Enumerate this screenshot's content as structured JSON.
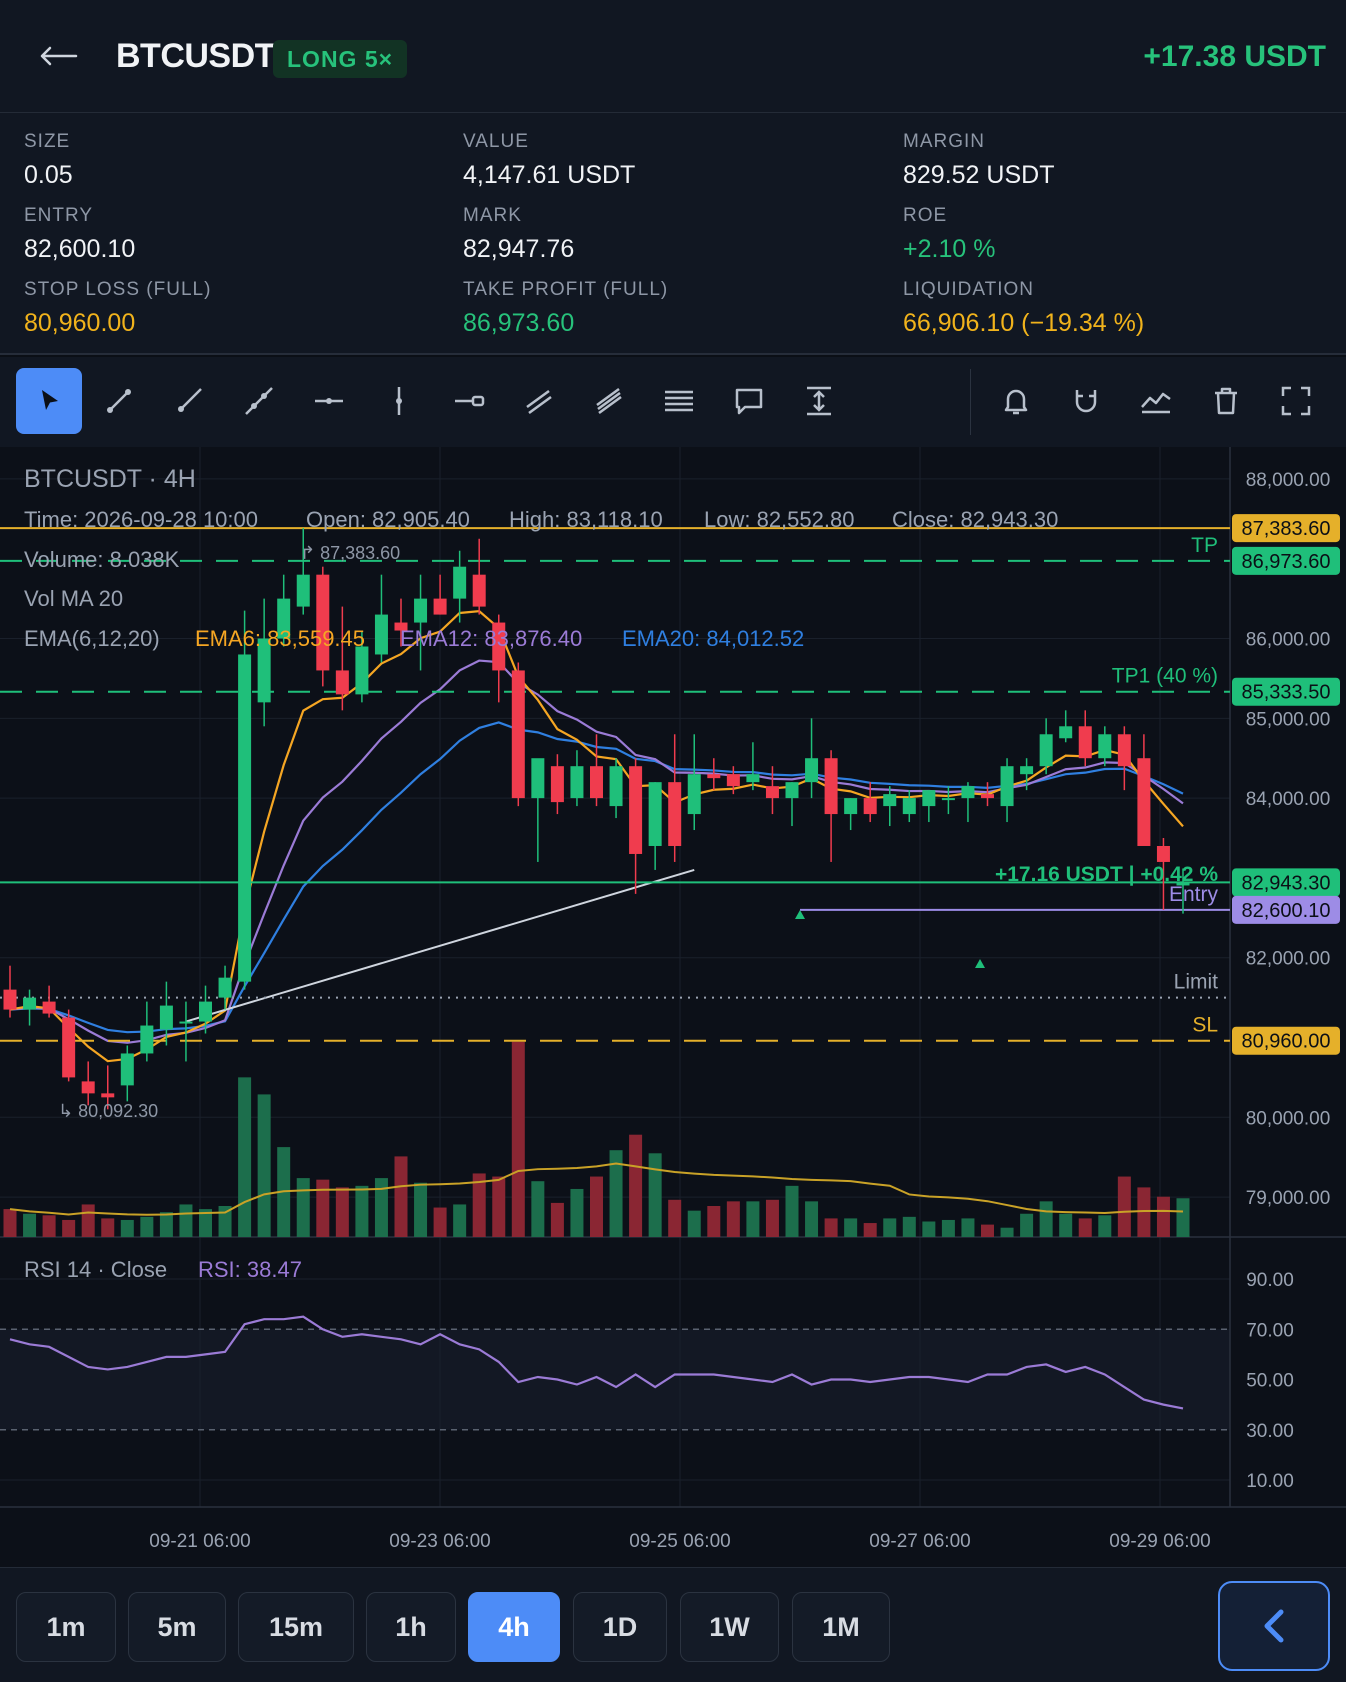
{
  "header": {
    "symbol": "BTCUSDT",
    "position_badge": "LONG 5×",
    "unrealized_pnl": "+17.38 USDT"
  },
  "stats": [
    {
      "label": "SIZE",
      "value": "0.05",
      "tone": "normal"
    },
    {
      "label": "VALUE",
      "value": "4,147.61 USDT",
      "tone": "normal"
    },
    {
      "label": "MARGIN",
      "value": "829.52 USDT",
      "tone": "normal"
    },
    {
      "label": "ENTRY",
      "value": "82,600.10",
      "tone": "normal"
    },
    {
      "label": "MARK",
      "value": "82,947.76",
      "tone": "normal"
    },
    {
      "label": "ROE",
      "value": "+2.10 %",
      "tone": "green"
    },
    {
      "label": "STOP LOSS (FULL)",
      "value": "80,960.00",
      "tone": "amber"
    },
    {
      "label": "TAKE PROFIT (FULL)",
      "value": "86,973.60",
      "tone": "green"
    },
    {
      "label": "LIQUIDATION",
      "value": "66,906.10 (−19.34 %)",
      "tone": "amber"
    }
  ],
  "toolbar": {
    "tools": [
      "cursor-icon",
      "trend-line-icon",
      "ray-icon",
      "extended-line-icon",
      "horizontal-line-icon",
      "vertical-line-icon",
      "horizontal-ray-icon",
      "parallel-channel-icon",
      "regression-channel-icon",
      "fib-levels-icon",
      "callout-icon",
      "price-range-icon"
    ],
    "actions": [
      "alert-bell-icon",
      "magnet-icon",
      "indicators-icon",
      "trash-icon",
      "fullscreen-icon"
    ]
  },
  "chart_data": {
    "type": "candlestick",
    "title": "BTCUSDT · 4H",
    "ohlc_legend": {
      "time": "Time: 2026-09-28 10:00",
      "open": "Open: 82,905.40",
      "high": "High: 83,118.10",
      "low": "Low: 82,552.80",
      "close": "Close: 82,943.30",
      "volume": "Volume: 8.038K",
      "vol_ma": "Vol MA 20"
    },
    "ema_legend": {
      "label": "EMA(6,12,20)",
      "ema6": "EMA6: 83,559.45",
      "ema12": "EMA12: 83,876.40",
      "ema20": "EMA20: 84,012.52"
    },
    "price_axis_ticks": [
      "88,000.00",
      "86,000.00",
      "85,000.00",
      "84,000.00",
      "82,000.00",
      "80,000.00",
      "79,000.00"
    ],
    "time_axis_ticks": [
      "09-21 06:00",
      "09-23 06:00",
      "09-25 06:00",
      "09-27 06:00",
      "09-29 06:00"
    ],
    "markers": {
      "swing_high": "87,383.60",
      "swing_low": "80,092.30"
    },
    "price_levels": [
      {
        "label": "",
        "price": 87383.6,
        "tag": "87,383.60",
        "color": "#e5b02a",
        "style": "solid"
      },
      {
        "label": "TP",
        "price": 86973.6,
        "tag": "86,973.60",
        "color": "#1fbf7a",
        "style": "dashed"
      },
      {
        "label": "TP1 (40 %)",
        "price": 85333.5,
        "tag": "85,333.50",
        "color": "#1fbf7a",
        "style": "dashed"
      },
      {
        "label": "",
        "price": 82943.3,
        "tag": "82,943.30",
        "color": "#1fbf7a",
        "style": "solid"
      },
      {
        "label": "Entry",
        "price": 82600.1,
        "tag": "82,600.10",
        "color": "#9d8ce6",
        "style": "solid"
      },
      {
        "label": "Limit",
        "price": 81500,
        "tag": "",
        "color": "#9aa3b2",
        "style": "dotted"
      },
      {
        "label": "SL",
        "price": 80960.0,
        "tag": "80,960.00",
        "color": "#e5b02a",
        "style": "dashed"
      }
    ],
    "position_pnl_label": "+17.16 USDT | +0.42 %",
    "candles": [
      {
        "o": 81600,
        "h": 81900,
        "l": 81250,
        "c": 81350
      },
      {
        "o": 81350,
        "h": 81600,
        "l": 81150,
        "c": 81500
      },
      {
        "o": 81450,
        "h": 81650,
        "l": 81250,
        "c": 81300
      },
      {
        "o": 81250,
        "h": 81350,
        "l": 80450,
        "c": 80500
      },
      {
        "o": 80450,
        "h": 80700,
        "l": 80150,
        "c": 80300
      },
      {
        "o": 80300,
        "h": 80650,
        "l": 80100,
        "c": 80250
      },
      {
        "o": 80400,
        "h": 80900,
        "l": 80200,
        "c": 80800
      },
      {
        "o": 80800,
        "h": 81450,
        "l": 80700,
        "c": 81150
      },
      {
        "o": 81100,
        "h": 81700,
        "l": 80900,
        "c": 81400
      },
      {
        "o": 81200,
        "h": 81450,
        "l": 80700,
        "c": 81200
      },
      {
        "o": 81200,
        "h": 81650,
        "l": 81050,
        "c": 81450
      },
      {
        "o": 81500,
        "h": 81900,
        "l": 81350,
        "c": 81750
      },
      {
        "o": 81700,
        "h": 86350,
        "l": 81600,
        "c": 85800
      },
      {
        "o": 85200,
        "h": 86500,
        "l": 84900,
        "c": 86000
      },
      {
        "o": 86000,
        "h": 86800,
        "l": 85900,
        "c": 86500
      },
      {
        "o": 86400,
        "h": 87383.6,
        "l": 86300,
        "c": 86800
      },
      {
        "o": 86800,
        "h": 86900,
        "l": 85400,
        "c": 85600
      },
      {
        "o": 85600,
        "h": 86400,
        "l": 85100,
        "c": 85300
      },
      {
        "o": 85300,
        "h": 86100,
        "l": 85200,
        "c": 85900
      },
      {
        "o": 85800,
        "h": 86800,
        "l": 85700,
        "c": 86300
      },
      {
        "o": 86200,
        "h": 86500,
        "l": 85900,
        "c": 86100
      },
      {
        "o": 86200,
        "h": 86800,
        "l": 85600,
        "c": 86500
      },
      {
        "o": 86500,
        "h": 86800,
        "l": 86300,
        "c": 86300
      },
      {
        "o": 86500,
        "h": 87100,
        "l": 86200,
        "c": 86900
      },
      {
        "o": 86800,
        "h": 87250,
        "l": 86300,
        "c": 86400
      },
      {
        "o": 86200,
        "h": 86300,
        "l": 85200,
        "c": 85600
      },
      {
        "o": 85600,
        "h": 85700,
        "l": 83900,
        "c": 84000
      },
      {
        "o": 84000,
        "h": 84400,
        "l": 83200,
        "c": 84500
      },
      {
        "o": 84400,
        "h": 84550,
        "l": 83800,
        "c": 83950
      },
      {
        "o": 84000,
        "h": 84600,
        "l": 83900,
        "c": 84400
      },
      {
        "o": 84400,
        "h": 84800,
        "l": 83900,
        "c": 84000
      },
      {
        "o": 83900,
        "h": 84500,
        "l": 83750,
        "c": 84400
      },
      {
        "o": 84400,
        "h": 84500,
        "l": 82800,
        "c": 83300
      },
      {
        "o": 83400,
        "h": 84200,
        "l": 83100,
        "c": 84200
      },
      {
        "o": 84200,
        "h": 84800,
        "l": 83200,
        "c": 83400
      },
      {
        "o": 83800,
        "h": 84800,
        "l": 83600,
        "c": 84300
      },
      {
        "o": 84300,
        "h": 84500,
        "l": 84100,
        "c": 84250
      },
      {
        "o": 84300,
        "h": 84400,
        "l": 84050,
        "c": 84150
      },
      {
        "o": 84200,
        "h": 84700,
        "l": 84100,
        "c": 84300
      },
      {
        "o": 84150,
        "h": 84400,
        "l": 83800,
        "c": 84000
      },
      {
        "o": 84000,
        "h": 84200,
        "l": 83650,
        "c": 84200
      },
      {
        "o": 84200,
        "h": 85000,
        "l": 84000,
        "c": 84500
      },
      {
        "o": 84500,
        "h": 84600,
        "l": 83200,
        "c": 83800
      },
      {
        "o": 83800,
        "h": 84000,
        "l": 83600,
        "c": 84000
      },
      {
        "o": 84000,
        "h": 84200,
        "l": 83700,
        "c": 83800
      },
      {
        "o": 83900,
        "h": 84150,
        "l": 83650,
        "c": 84050
      },
      {
        "o": 83800,
        "h": 84100,
        "l": 83700,
        "c": 84000
      },
      {
        "o": 83900,
        "h": 84100,
        "l": 83700,
        "c": 84100
      },
      {
        "o": 84000,
        "h": 84150,
        "l": 83800,
        "c": 84000
      },
      {
        "o": 84000,
        "h": 84200,
        "l": 83700,
        "c": 84150
      },
      {
        "o": 84050,
        "h": 84200,
        "l": 83900,
        "c": 84000
      },
      {
        "o": 83900,
        "h": 84500,
        "l": 83700,
        "c": 84400
      },
      {
        "o": 84300,
        "h": 84500,
        "l": 84100,
        "c": 84400
      },
      {
        "o": 84400,
        "h": 85000,
        "l": 84300,
        "c": 84800
      },
      {
        "o": 84750,
        "h": 85100,
        "l": 84700,
        "c": 84900
      },
      {
        "o": 84900,
        "h": 85100,
        "l": 84400,
        "c": 84500
      },
      {
        "o": 84500,
        "h": 84900,
        "l": 84400,
        "c": 84800
      },
      {
        "o": 84800,
        "h": 84900,
        "l": 84100,
        "c": 84400
      },
      {
        "o": 84500,
        "h": 84800,
        "l": 83800,
        "c": 83400
      },
      {
        "o": 83400,
        "h": 83500,
        "l": 82600,
        "c": 83200
      },
      {
        "o": 82905.4,
        "h": 83118.1,
        "l": 82552.8,
        "c": 82943.3
      }
    ],
    "volumes": [
      1.8,
      1.5,
      1.4,
      1.1,
      2.1,
      1.2,
      1.1,
      1.3,
      1.6,
      2.1,
      1.8,
      2.0,
      10.3,
      9.2,
      5.8,
      3.8,
      3.7,
      3.2,
      3.3,
      3.8,
      5.2,
      3.5,
      1.9,
      2.1,
      4.1,
      3.9,
      12.6,
      3.6,
      2.2,
      3.1,
      3.9,
      5.6,
      6.6,
      5.4,
      2.4,
      1.7,
      2.0,
      2.3,
      2.3,
      2.4,
      3.3,
      2.3,
      1.2,
      1.2,
      0.9,
      1.2,
      1.3,
      1.0,
      1.1,
      1.2,
      0.8,
      0.6,
      1.5,
      2.3,
      1.5,
      1.2,
      1.4,
      3.9,
      3.2,
      2.6,
      2.5
    ],
    "rsi": {
      "label": "RSI 14 · Close",
      "value_label": "RSI: 38.47",
      "axis_ticks": [
        "90.00",
        "70.00",
        "50.00",
        "30.00",
        "10.00"
      ],
      "upper_band": 70,
      "lower_band": 30,
      "values": [
        66,
        64,
        63,
        59,
        55,
        54,
        55,
        57,
        59,
        59,
        60,
        61,
        72,
        74,
        74,
        75,
        70,
        67,
        68,
        67,
        66,
        64,
        68,
        64,
        62,
        57,
        49,
        51,
        50,
        48,
        51,
        47,
        52,
        47,
        52,
        52,
        52,
        51,
        50,
        49,
        52,
        48,
        50,
        50,
        49,
        50,
        51,
        51,
        50,
        49,
        52,
        52,
        55,
        56,
        53,
        55,
        52,
        47,
        42,
        40,
        38.47
      ]
    },
    "ylim": [
      78500,
      88400
    ]
  },
  "timeframes": [
    {
      "label": "1m",
      "active": false
    },
    {
      "label": "5m",
      "active": false
    },
    {
      "label": "15m",
      "active": false
    },
    {
      "label": "1h",
      "active": false
    },
    {
      "label": "4h",
      "active": true
    },
    {
      "label": "1D",
      "active": false
    },
    {
      "label": "1W",
      "active": false
    },
    {
      "label": "1M",
      "active": false
    }
  ],
  "colors": {
    "up": "#1fbf7a",
    "down": "#f03c4e",
    "ema6": "#f5a623",
    "ema12": "#9b7bd6",
    "ema20": "#2f7fe0",
    "accent": "#4d8cf7"
  }
}
